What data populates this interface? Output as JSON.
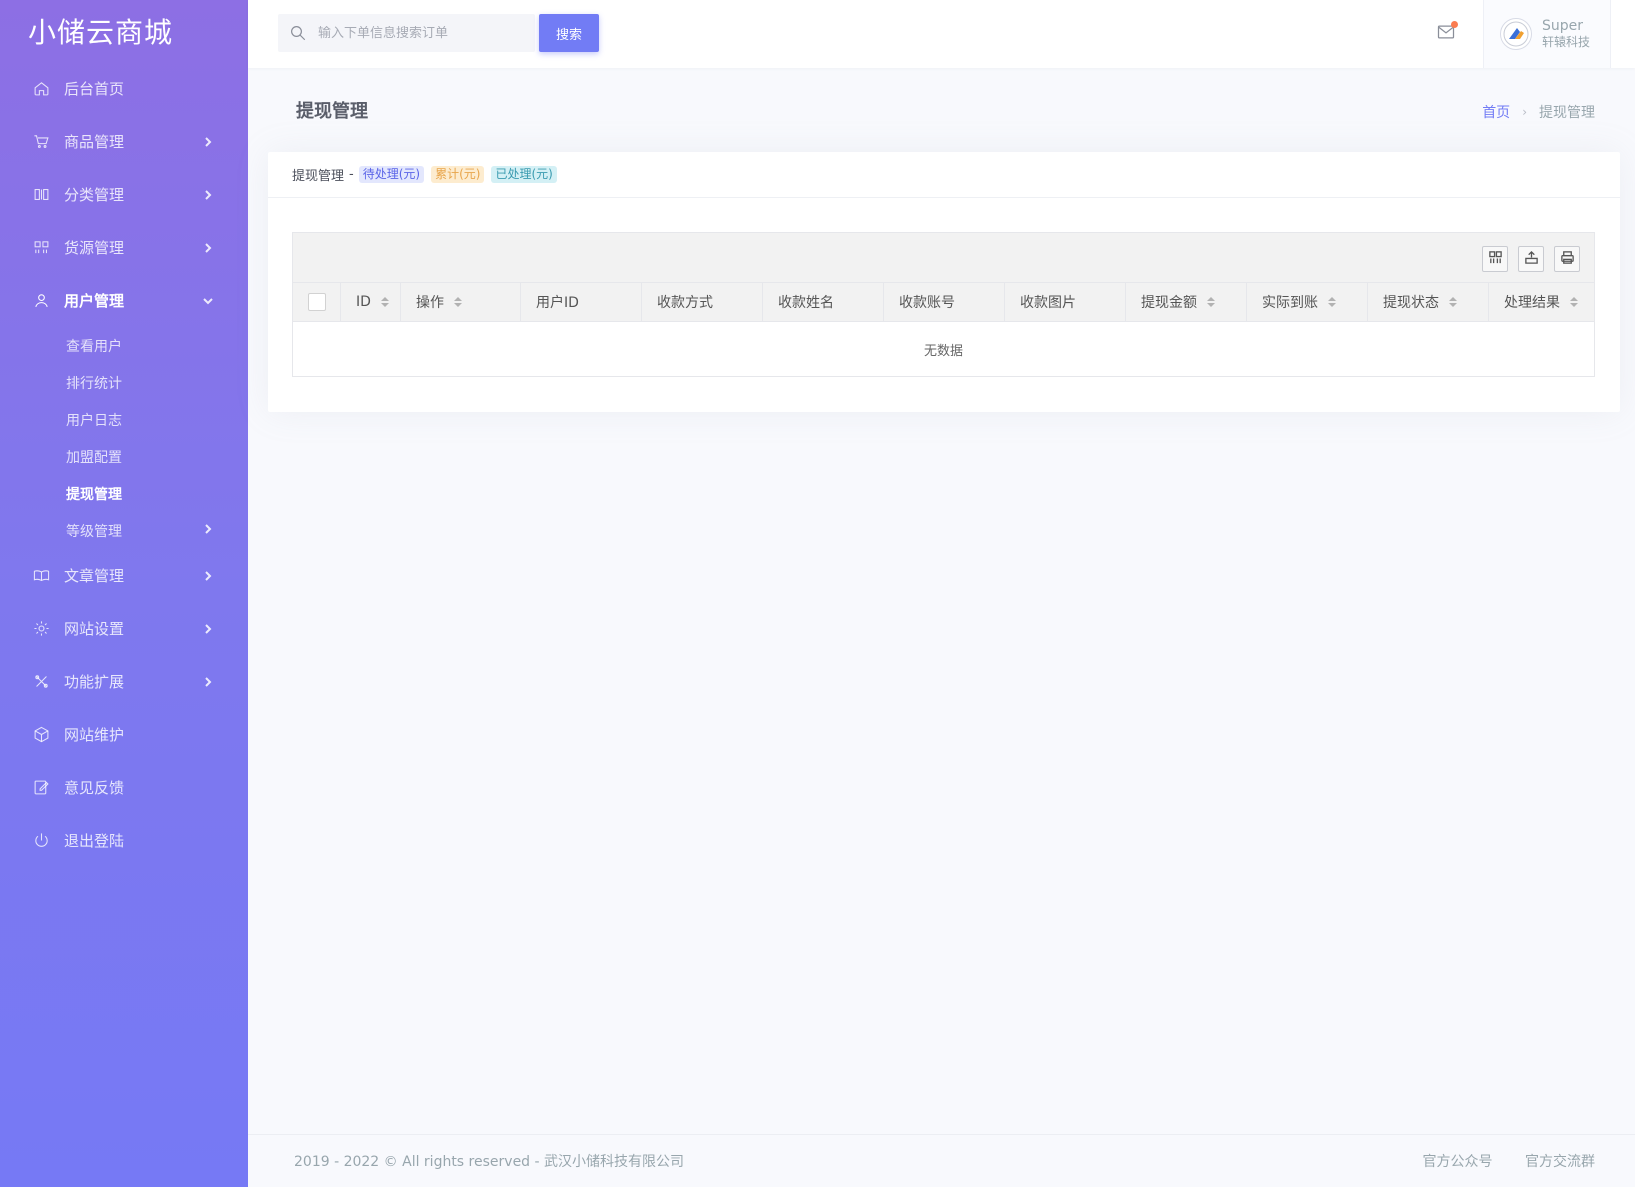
{
  "brand": "小储云商城",
  "sidebar": {
    "items": [
      {
        "label": "后台首页",
        "icon": "home-icon",
        "has_children": false
      },
      {
        "label": "商品管理",
        "icon": "cart-icon",
        "has_children": true
      },
      {
        "label": "分类管理",
        "icon": "columns-icon",
        "has_children": true
      },
      {
        "label": "货源管理",
        "icon": "grid-icon",
        "has_children": true
      },
      {
        "label": "用户管理",
        "icon": "user-icon",
        "has_children": true,
        "expanded": true
      },
      {
        "label": "文章管理",
        "icon": "book-icon",
        "has_children": true
      },
      {
        "label": "网站设置",
        "icon": "gear-icon",
        "has_children": true
      },
      {
        "label": "功能扩展",
        "icon": "tools-icon",
        "has_children": true
      },
      {
        "label": "网站维护",
        "icon": "box-icon",
        "has_children": false
      },
      {
        "label": "意见反馈",
        "icon": "edit-icon",
        "has_children": false
      },
      {
        "label": "退出登陆",
        "icon": "power-icon",
        "has_children": false
      }
    ],
    "user_sub": [
      {
        "label": "查看用户"
      },
      {
        "label": "排行统计"
      },
      {
        "label": "用户日志"
      },
      {
        "label": "加盟配置"
      },
      {
        "label": "提现管理",
        "active": true
      },
      {
        "label": "等级管理",
        "has_children": true
      }
    ]
  },
  "topbar": {
    "search_placeholder": "输入下单信息搜索订单",
    "search_button": "搜索",
    "user_name": "Super",
    "user_org": "轩辕科技",
    "notification_color": "#fa7c50"
  },
  "page": {
    "title": "提现管理",
    "breadcrumb_home": "首页",
    "breadcrumb_current": "提现管理"
  },
  "card": {
    "header_title": "提现管理",
    "header_dash": "-",
    "tags": [
      {
        "label": "待处理(元)",
        "color": "blue"
      },
      {
        "label": "累计(元)",
        "color": "orange"
      },
      {
        "label": "已处理(元)",
        "color": "cyan"
      }
    ]
  },
  "table": {
    "toolbar": [
      "columns-icon",
      "export-icon",
      "print-icon"
    ],
    "columns": [
      {
        "label": "ID",
        "sortable": true
      },
      {
        "label": "操作",
        "sortable": true
      },
      {
        "label": "用户ID",
        "sortable": false
      },
      {
        "label": "收款方式",
        "sortable": false
      },
      {
        "label": "收款姓名",
        "sortable": false
      },
      {
        "label": "收款账号",
        "sortable": false
      },
      {
        "label": "收款图片",
        "sortable": false
      },
      {
        "label": "提现金额",
        "sortable": true
      },
      {
        "label": "实际到账",
        "sortable": true
      },
      {
        "label": "提现状态",
        "sortable": true
      },
      {
        "label": "处理结果",
        "sortable": true
      }
    ],
    "empty_text": "无数据"
  },
  "footer": {
    "copyright": "2019 - 2022 © All rights reserved - 武汉小储科技有限公司",
    "link1": "官方公众号",
    "link2": "官方交流群"
  },
  "colors": {
    "accent": "#727cf5",
    "sidebar_top": "#8d6fe4",
    "sidebar_bottom": "#7679f5"
  }
}
